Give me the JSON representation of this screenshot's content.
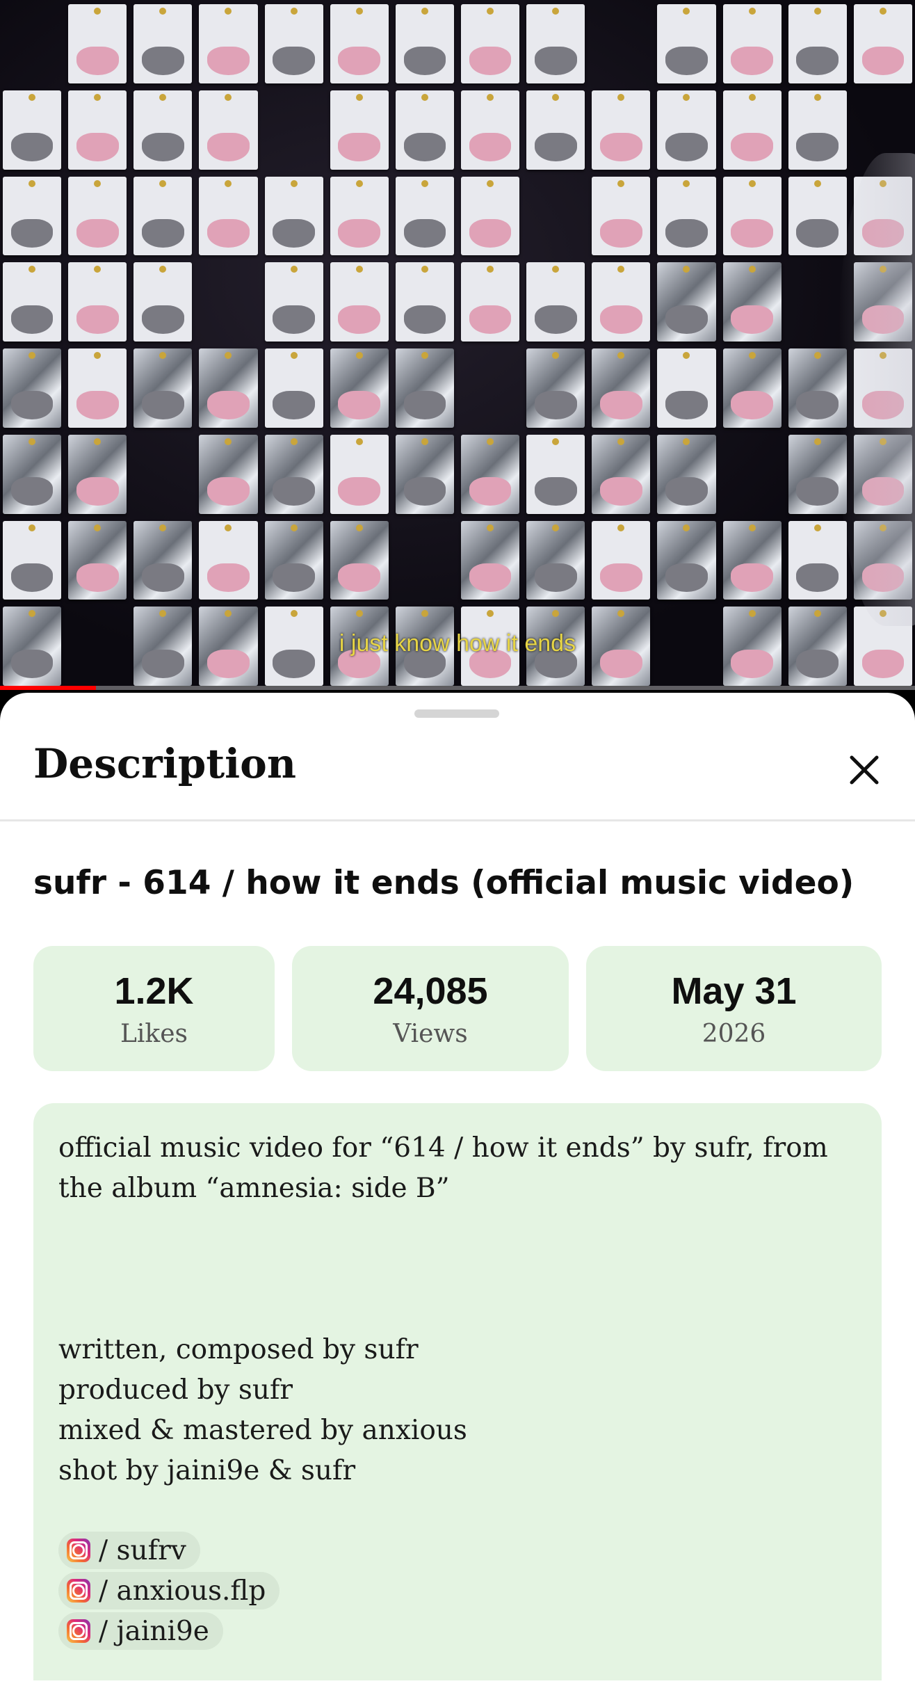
{
  "video": {
    "caption": "i just know how it ends",
    "progress_percent": 10.5,
    "colors": {
      "progress": "#ff0000",
      "caption": "#e7d545"
    }
  },
  "sheet": {
    "title": "Description",
    "close_icon": "close-icon",
    "video_title": "sufr - 614 / how it ends (official music video)",
    "stats": [
      {
        "value": "1.2K",
        "label": "Likes"
      },
      {
        "value": "24,085",
        "label": "Views"
      },
      {
        "value": "May 31",
        "label": "2026"
      }
    ],
    "description": {
      "intro_line_1": "official music video for “614 / how it ends” by sufr, from",
      "intro_line_2": "the album “amnesia: side B”",
      "credits": [
        "written, composed by sufr",
        "produced by sufr",
        "mixed & mastered by anxious",
        "shot by jaini9e & sufr"
      ],
      "socials": [
        {
          "icon": "instagram-icon",
          "text": "/ sufrv"
        },
        {
          "icon": "instagram-icon",
          "text": "/ anxious.flp"
        },
        {
          "icon": "instagram-icon",
          "text": "/ jaini9e"
        }
      ]
    },
    "colors": {
      "stat_bg": "#e4f4e2",
      "chip_bg": "#d7e7d5"
    }
  }
}
